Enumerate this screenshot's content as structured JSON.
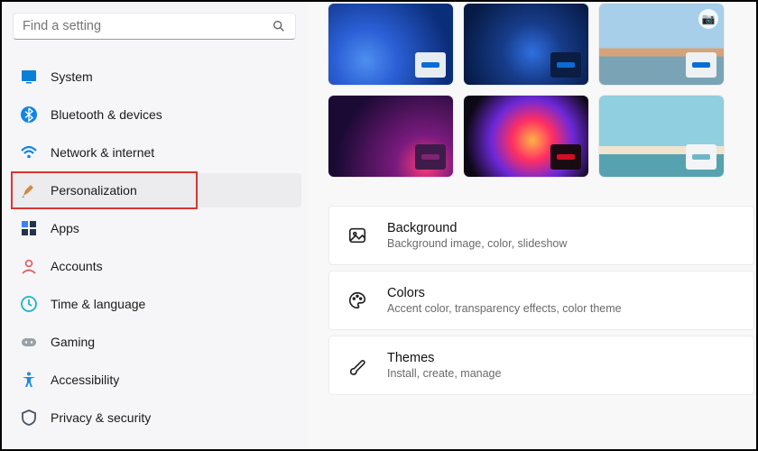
{
  "search": {
    "placeholder": "Find a setting"
  },
  "sidebar": {
    "items": [
      {
        "label": "System"
      },
      {
        "label": "Bluetooth & devices"
      },
      {
        "label": "Network & internet"
      },
      {
        "label": "Personalization"
      },
      {
        "label": "Apps"
      },
      {
        "label": "Accounts"
      },
      {
        "label": "Time & language"
      },
      {
        "label": "Gaming"
      },
      {
        "label": "Accessibility"
      },
      {
        "label": "Privacy & security"
      }
    ]
  },
  "cards": {
    "background": {
      "title": "Background",
      "sub": "Background image, color, slideshow"
    },
    "colors": {
      "title": "Colors",
      "sub": "Accent color, transparency effects, color theme"
    },
    "themes": {
      "title": "Themes",
      "sub": "Install, create, manage"
    }
  }
}
